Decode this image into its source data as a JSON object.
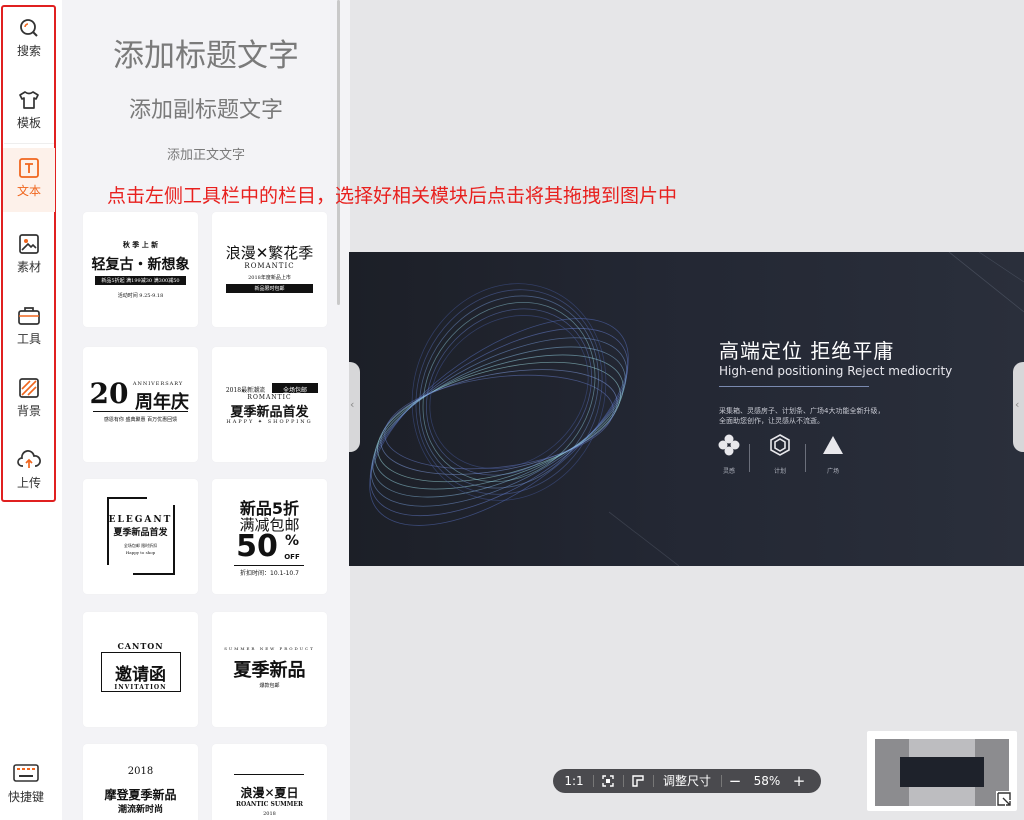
{
  "sidebar": {
    "items": [
      {
        "label": "搜索",
        "icon": "search-icon"
      },
      {
        "label": "模板",
        "icon": "tshirt-icon"
      },
      {
        "label": "文本",
        "icon": "text-icon"
      },
      {
        "label": "素材",
        "icon": "image-icon"
      },
      {
        "label": "工具",
        "icon": "toolbox-icon"
      },
      {
        "label": "背景",
        "icon": "background-icon"
      },
      {
        "label": "上传",
        "icon": "cloud-upload-icon"
      }
    ],
    "active_item": "文本",
    "shortcut_label": "快捷键",
    "accent_color": "#f0661e",
    "highlight_color": "#e02020"
  },
  "panel": {
    "title_preset": "添加标题文字",
    "subtitle_preset": "添加副标题文字",
    "body_preset": "添加正文文字",
    "templates": [
      {
        "lines": [
          "秋 季 上 新",
          "轻复古・新想象",
          "新品5折起 满199减30 满300减50",
          "活动时间 9.25-9.18"
        ]
      },
      {
        "lines": [
          "浪漫✕繁花季",
          "ROMANTIC",
          "2018年度新品上市",
          "新品限时包邮"
        ]
      },
      {
        "lines": [
          "ANNIVERSARY",
          "20",
          "周年庆",
          "感恩有你 盛典聚惠 百万优惠回馈"
        ]
      },
      {
        "lines": [
          "2018最新潮流",
          "全场包邮",
          "ROMANTIC",
          "夏季新品首发",
          "HAPPY ✦ SHOPPING"
        ]
      },
      {
        "lines": [
          "ELEGANT",
          "夏季新品首发",
          "全场包邮 限时折扣",
          "Happy to shop"
        ]
      },
      {
        "lines": [
          "新品5折",
          "满减包邮",
          "50",
          "%",
          "OFF",
          "折扣时间：10.1-10.7"
        ]
      },
      {
        "lines": [
          "CANTON",
          "邀请函",
          "INVITATION"
        ]
      },
      {
        "lines": [
          "SUMMER NEW PRODUCT",
          "夏季新品",
          "爆款包邮"
        ]
      },
      {
        "lines": [
          "2018",
          "摩登夏季新品",
          "潮流新时尚"
        ]
      },
      {
        "lines": [
          "浪漫✕夏日",
          "ROANTIC SUMMER",
          "2018"
        ]
      }
    ]
  },
  "annotation": "点击左侧工具栏中的栏目，选择好相关模块后点击将其拖拽到图片中",
  "canvas": {
    "title": "高端定位  拒绝平庸",
    "subtitle": "High-end positioning Reject mediocrity",
    "desc_line1": "采集箱、灵感房子、计划条、广场4大功能全新升级，",
    "desc_line2": "全面助您创作，让灵感从不流逝。",
    "icons": [
      {
        "caption": "灵感",
        "icon": "flower-icon"
      },
      {
        "caption": "计划",
        "icon": "hexagon-icon"
      },
      {
        "caption": "广场",
        "icon": "triangle-icon"
      }
    ]
  },
  "zoom": {
    "ratio_label": "1:1",
    "adjust_label": "调整尺寸",
    "minus": "−",
    "value": "58%",
    "plus": "+"
  }
}
